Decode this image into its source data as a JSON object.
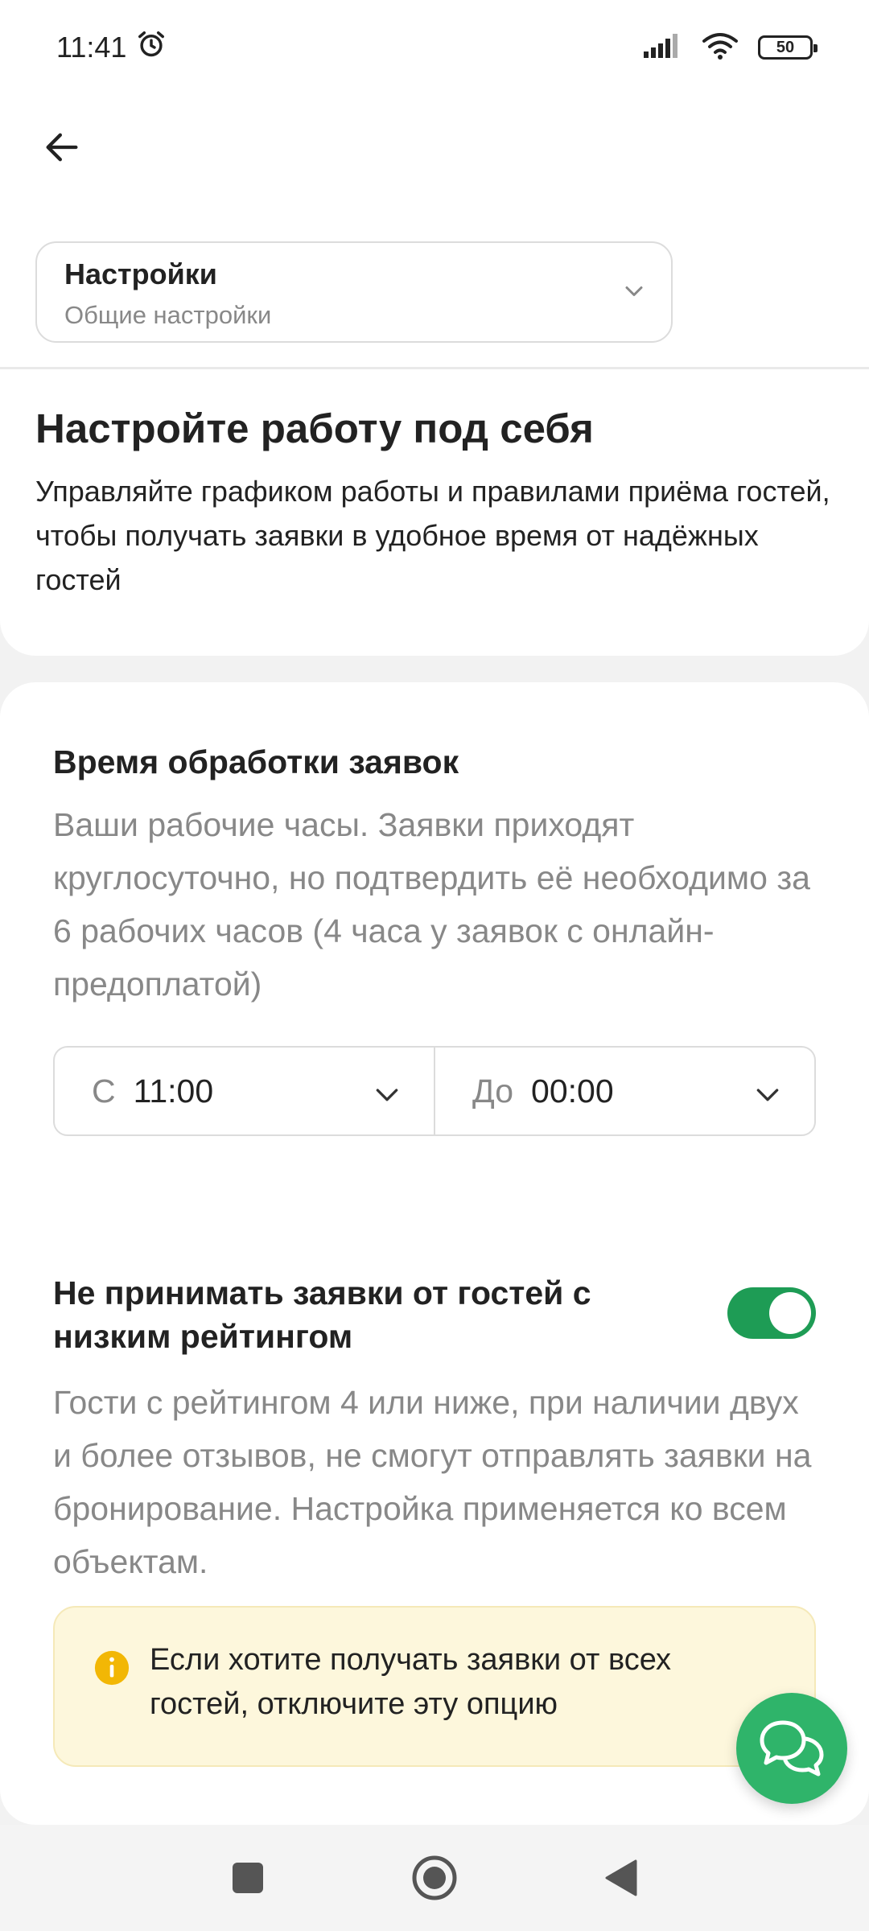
{
  "status_bar": {
    "time": "11:41",
    "battery": "50",
    "icons": [
      "alarm-icon",
      "signal-icon",
      "wifi-icon",
      "battery-icon"
    ]
  },
  "header": {
    "back_icon": "arrow-left-icon",
    "settings_select": {
      "title": "Настройки",
      "subtitle": "Общие настройки"
    }
  },
  "intro": {
    "title": "Настройте работу под себя",
    "description": "Управляйте графиком работы и правилами приёма гостей, чтобы получать заявки в удобное время от надёжных гостей"
  },
  "processing_time": {
    "title": "Время обработки заявок",
    "description": "Ваши рабочие часы. Заявки приходят круглосуточно, но подтвердить её необходимо за 6 рабочих часов (4 часа у заявок с онлайн-предоплатой)",
    "from": {
      "prefix": "С",
      "value": "11:00"
    },
    "to": {
      "prefix": "До",
      "value": "00:00"
    }
  },
  "low_rating": {
    "title": "Не принимать заявки от гостей с низким рейтингом",
    "enabled": true,
    "description": "Гости с рейтингом 4 или ниже, при наличии двух и более отзывов, не смогут отправлять заявки на бронирование. Настройка применяется ко всем объектам.",
    "info": "Если хотите получать заявки от всех гостей, отключите эту опцию"
  },
  "colors": {
    "accent_green": "#1e9c55",
    "fab_green": "#2fb46a",
    "info_background": "#fdf7dc",
    "info_icon": "#f2b705"
  },
  "nav_bar": {
    "icons": [
      "square-icon",
      "home-circle-icon",
      "back-triangle-icon"
    ]
  }
}
